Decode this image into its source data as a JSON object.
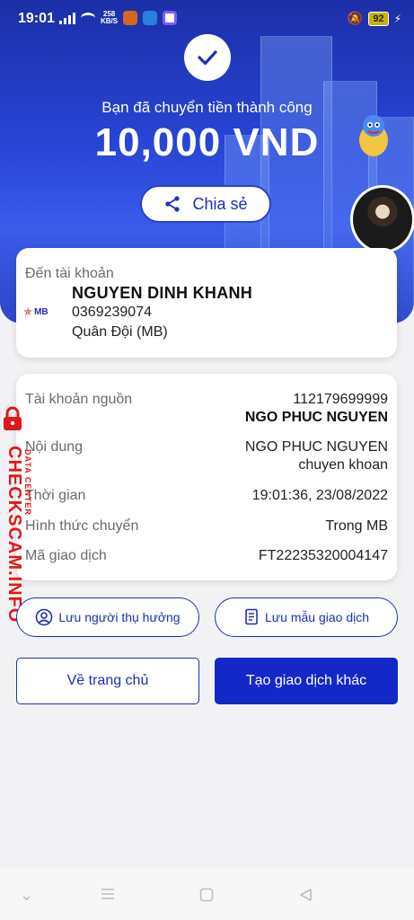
{
  "status_bar": {
    "time": "19:01",
    "net_speed_value": "258",
    "net_speed_unit": "KB/S",
    "battery": "92"
  },
  "hero": {
    "success_message": "Bạn đã chuyển tiền thành công",
    "amount": "10,000 VND",
    "share_label": "Chia sẻ"
  },
  "destination": {
    "label": "Đến tài khoản",
    "bank_logo_text": "MB",
    "name": "NGUYEN DINH KHANH",
    "account_number": "0369239074",
    "bank_name": "Quân Đội (MB)"
  },
  "details": {
    "source_label": "Tài khoản nguồn",
    "source_account": "112179699999",
    "source_name": "NGO PHUC NGUYEN",
    "content_label": "Nội dung",
    "content_line1": "NGO PHUC NGUYEN",
    "content_line2": "chuyen khoan",
    "time_label": "Thời gian",
    "time_value": "19:01:36, 23/08/2022",
    "method_label": "Hình thức chuyển",
    "method_value": "Trong MB",
    "txn_label": "Mã giao dịch",
    "txn_value": "FT22235320004147"
  },
  "actions": {
    "save_beneficiary": "Lưu người thụ hưởng",
    "save_template": "Lưu mẫu giao dịch",
    "home": "Về trang chủ",
    "new_transaction": "Tạo giao dịch khác"
  },
  "watermark": {
    "site": "CHECKSCAM.INFO",
    "tag": "DATA CENTER"
  },
  "colors": {
    "brand_blue": "#1428c8",
    "watermark_red": "#e01818"
  }
}
